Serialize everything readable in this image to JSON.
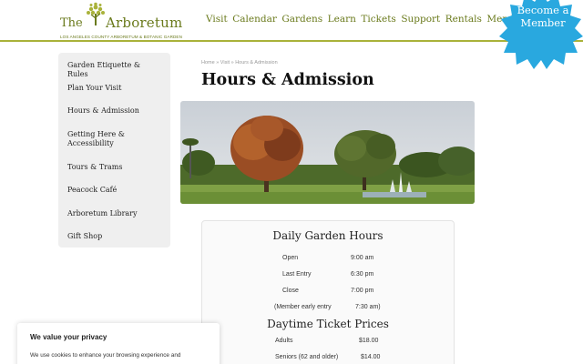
{
  "header": {
    "logo_the": "The",
    "logo_name": "Arboretum",
    "logo_subtitle": "LOS ANGELES COUNTY ARBORETUM & BOTANIC GARDEN",
    "nav": [
      "Visit",
      "Calendar",
      "Gardens",
      "Learn",
      "Tickets",
      "Support",
      "Rentals",
      "Member Login"
    ],
    "badge_line1": "Become a",
    "badge_line2": "Member"
  },
  "sidebar": {
    "items": [
      {
        "label": "Garden Etiquette & Rules"
      },
      {
        "label": "Plan Your Visit"
      },
      {
        "label": "Hours & Admission"
      },
      {
        "label_line1": "Getting Here &",
        "label_line2": "Accessibility"
      },
      {
        "label": "Tours & Trams"
      },
      {
        "label": "Peacock Café"
      },
      {
        "label": "Arboretum Library"
      },
      {
        "label": "Gift Shop"
      }
    ]
  },
  "breadcrumb": "Home » Visit » Hours & Admission",
  "page_title": "Hours & Admission",
  "hours_card": {
    "heading": "Daily Garden Hours",
    "rows": [
      {
        "label": "Open",
        "value": "9:00 am"
      },
      {
        "label": "Last Entry",
        "value": "6:30 pm"
      },
      {
        "label": "Close",
        "value": "7:00 pm"
      },
      {
        "label": "(Member early entry",
        "value": "7:30 am)"
      }
    ],
    "prices_heading": "Daytime Ticket Prices",
    "prices": [
      {
        "label": "Adults",
        "value": "$18.00"
      },
      {
        "label": "Seniors (62 and older)",
        "value": "$14.00"
      }
    ]
  },
  "cookie": {
    "title": "We value your privacy",
    "text": "We use cookies to enhance your browsing experience and"
  },
  "colors": {
    "brand_olive": "#6a7a1c",
    "header_rule": "#a9b23a",
    "badge_blue": "#29a8df"
  }
}
